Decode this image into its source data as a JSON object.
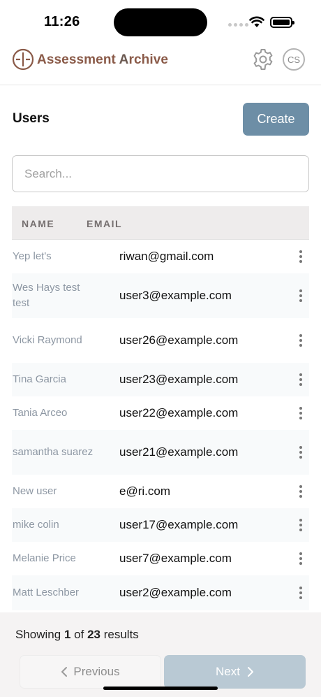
{
  "status_bar": {
    "time": "11:26"
  },
  "header": {
    "app_title_part1": "Assessment ",
    "app_title_part2": "A",
    "app_title_part3": "rchive",
    "avatar_initials": "CS"
  },
  "page": {
    "title": "Users",
    "create_label": "Create"
  },
  "search": {
    "placeholder": "Search..."
  },
  "table": {
    "columns": [
      "NAME",
      "EMAIL"
    ],
    "rows": [
      {
        "name": "Yep let's",
        "email": "riwan@gmail.com"
      },
      {
        "name": "Wes Hays test test",
        "email": "user3@example.com"
      },
      {
        "name": "Vicki Raymond",
        "email": "user26@example.com"
      },
      {
        "name": "Tina Garcia",
        "email": "user23@example.com"
      },
      {
        "name": "Tania Arceo",
        "email": "user22@example.com"
      },
      {
        "name": "samantha suarez",
        "email": "user21@example.com"
      },
      {
        "name": "New user",
        "email": "e@ri.com"
      },
      {
        "name": "mike colin",
        "email": "user17@example.com"
      },
      {
        "name": "Melanie Price",
        "email": "user7@example.com"
      },
      {
        "name": "Matt Leschber",
        "email": "user2@example.com"
      }
    ]
  },
  "pagination": {
    "showing_label": "Showing",
    "current": "1",
    "of_label": "of",
    "total": "23",
    "results_label": "results",
    "previous_label": "Previous",
    "next_label": "Next"
  },
  "icons": {
    "logo": "scale-icon",
    "settings": "gear-icon",
    "row_menu": "more-vertical-icon",
    "prev": "chevron-left-icon",
    "next": "chevron-right-icon"
  },
  "colors": {
    "brand": "#8a5a48",
    "primary_button": "#6d8ea6",
    "disabled_button": "#b9c9d4",
    "name_text": "#8d97a3"
  }
}
